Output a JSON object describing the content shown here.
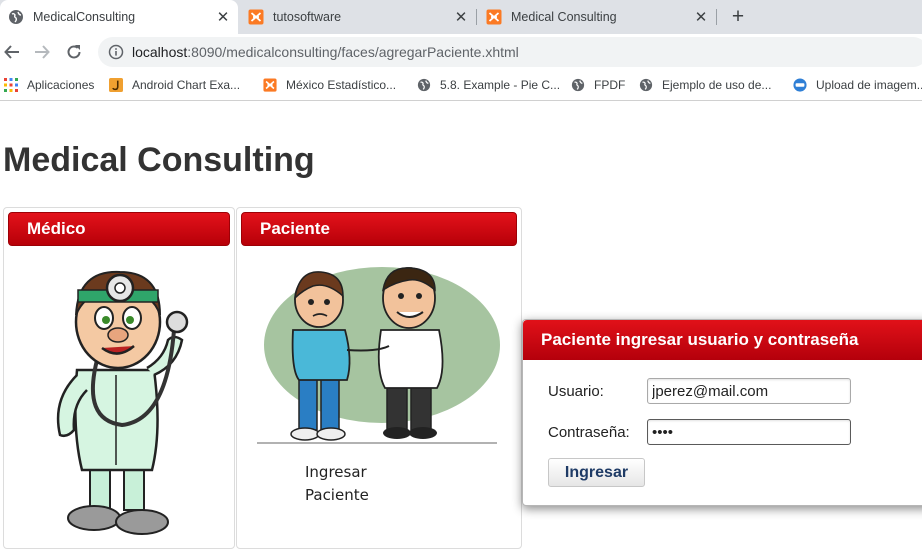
{
  "browser": {
    "tabs": [
      {
        "title": "MedicalConsulting",
        "favicon": "globe-icon"
      },
      {
        "title": "tutosoftware",
        "favicon": "xampp-icon"
      },
      {
        "title": "Medical Consulting",
        "favicon": "xampp-icon"
      }
    ],
    "url_host": "localhost",
    "url_path": ":8090/medicalconsulting/faces/agregarPaciente.xhtml",
    "bookmarks": [
      {
        "label": "Aplicaciones",
        "icon": "apps-grid-icon"
      },
      {
        "label": "Android Chart Exa...",
        "icon": "java-icon"
      },
      {
        "label": "México Estadístico...",
        "icon": "xampp-icon"
      },
      {
        "label": "5.8. Example - Pie C...",
        "icon": "globe-icon"
      },
      {
        "label": "FPDF",
        "icon": "globe-icon"
      },
      {
        "label": "Ejemplo de uso de...",
        "icon": "globe-icon"
      },
      {
        "label": "Upload de imagem...",
        "icon": "site-icon"
      }
    ]
  },
  "page": {
    "title": "Medical Consulting",
    "panels": {
      "medico": {
        "header": "Médico"
      },
      "paciente": {
        "header": "Paciente",
        "link_line1": "Ingresar",
        "link_line2": "Paciente"
      }
    }
  },
  "login_dialog": {
    "title": "Paciente ingresar usuario y contraseña",
    "username_label": "Usuario:",
    "username_value": "jperez@mail.com",
    "password_label": "Contraseña:",
    "password_value": "1234",
    "submit_label": "Ingresar"
  },
  "colors": {
    "accent": "#cc0000",
    "button_text": "#1f3b66"
  }
}
